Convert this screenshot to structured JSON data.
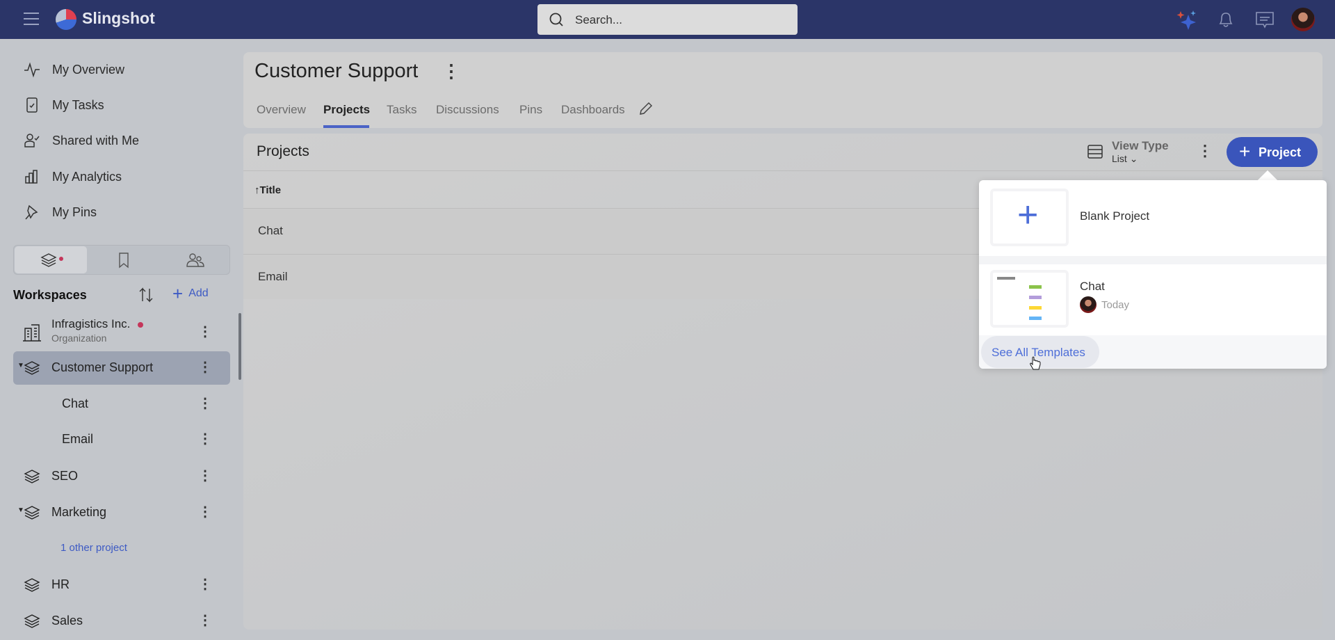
{
  "app": {
    "name": "Slingshot",
    "search_placeholder": "Search...",
    "accent": "#3a55bb"
  },
  "header_icons": [
    "sparkle-icon",
    "bell-icon",
    "chat-icon",
    "avatar"
  ],
  "nav": [
    {
      "label": "My Overview",
      "icon": "activity-icon"
    },
    {
      "label": "My Tasks",
      "icon": "clipboard-check-icon"
    },
    {
      "label": "Shared with Me",
      "icon": "user-check-icon"
    },
    {
      "label": "My Analytics",
      "icon": "bar-chart-icon"
    },
    {
      "label": "My Pins",
      "icon": "pin-icon"
    }
  ],
  "workspaces": {
    "title": "Workspaces",
    "add": "Add",
    "items": [
      {
        "label": "Infragistics Inc.",
        "sub": "Organization"
      },
      {
        "label": "Customer Support"
      },
      {
        "label": "Chat"
      },
      {
        "label": "Email"
      },
      {
        "label": "SEO"
      },
      {
        "label": "Marketing"
      },
      {
        "label": "1 other project"
      },
      {
        "label": "HR"
      },
      {
        "label": "Sales"
      }
    ]
  },
  "page": {
    "title": "Customer Support",
    "tabs": [
      "Overview",
      "Projects",
      "Tasks",
      "Discussions",
      "Pins",
      "Dashboards"
    ],
    "active_tab": "Projects"
  },
  "projects": {
    "title": "Projects",
    "view_type_label": "View Type",
    "view_type_value": "List",
    "new_button": "Project",
    "column": "Title",
    "rows": [
      "Chat",
      "Email"
    ]
  },
  "dropdown": {
    "blank": "Blank Project",
    "template_name": "Chat",
    "template_date": "Today",
    "see_all": "See All Templates"
  }
}
